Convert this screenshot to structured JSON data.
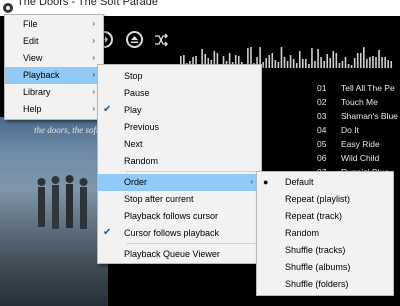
{
  "window": {
    "title": "The Doors - The Soft Parade"
  },
  "controls": [
    {
      "name": "next-track-icon",
      "glyph": "⏭"
    },
    {
      "name": "eject-icon",
      "glyph": "⏏"
    },
    {
      "name": "shuffle-icon",
      "glyph": "⤨"
    }
  ],
  "album_art": {
    "text": "the doors, the soft parade"
  },
  "playlist": {
    "rows": [
      {
        "num": "01",
        "title": "Tell All The Pe"
      },
      {
        "num": "02",
        "title": "Touch Me"
      },
      {
        "num": "03",
        "title": "Shaman's Blue"
      },
      {
        "num": "04",
        "title": "Do It"
      },
      {
        "num": "05",
        "title": "Easy Ride"
      },
      {
        "num": "06",
        "title": "Wild Child"
      },
      {
        "num": "07",
        "title": "Runnin' Blue"
      }
    ]
  },
  "main_menu": {
    "items": [
      {
        "label": "File"
      },
      {
        "label": "Edit"
      },
      {
        "label": "View"
      },
      {
        "label": "Playback"
      },
      {
        "label": "Library"
      },
      {
        "label": "Help"
      }
    ]
  },
  "playback_menu": {
    "items": [
      {
        "label": "Stop",
        "checked": false,
        "submenu": false
      },
      {
        "label": "Pause",
        "checked": false,
        "submenu": false
      },
      {
        "label": "Play",
        "checked": true,
        "submenu": false
      },
      {
        "label": "Previous",
        "checked": false,
        "submenu": false
      },
      {
        "label": "Next",
        "checked": false,
        "submenu": false
      },
      {
        "label": "Random",
        "checked": false,
        "submenu": false
      },
      {
        "label": "Order",
        "checked": false,
        "submenu": true
      },
      {
        "label": "Stop after current",
        "checked": false,
        "submenu": false
      },
      {
        "label": "Playback follows cursor",
        "checked": false,
        "submenu": false
      },
      {
        "label": "Cursor follows playback",
        "checked": true,
        "submenu": false
      },
      {
        "label": "Playback Queue Viewer",
        "checked": false,
        "submenu": false
      }
    ]
  },
  "order_menu": {
    "selected": "Default",
    "items": [
      {
        "label": "Default"
      },
      {
        "label": "Repeat (playlist)"
      },
      {
        "label": "Repeat (track)"
      },
      {
        "label": "Random"
      },
      {
        "label": "Shuffle (tracks)"
      },
      {
        "label": "Shuffle (albums)"
      },
      {
        "label": "Shuffle (folders)"
      }
    ]
  },
  "colors": {
    "highlight": "#91c9f7",
    "menu_bg": "#f2f2f2",
    "player_bg": "#000000"
  }
}
